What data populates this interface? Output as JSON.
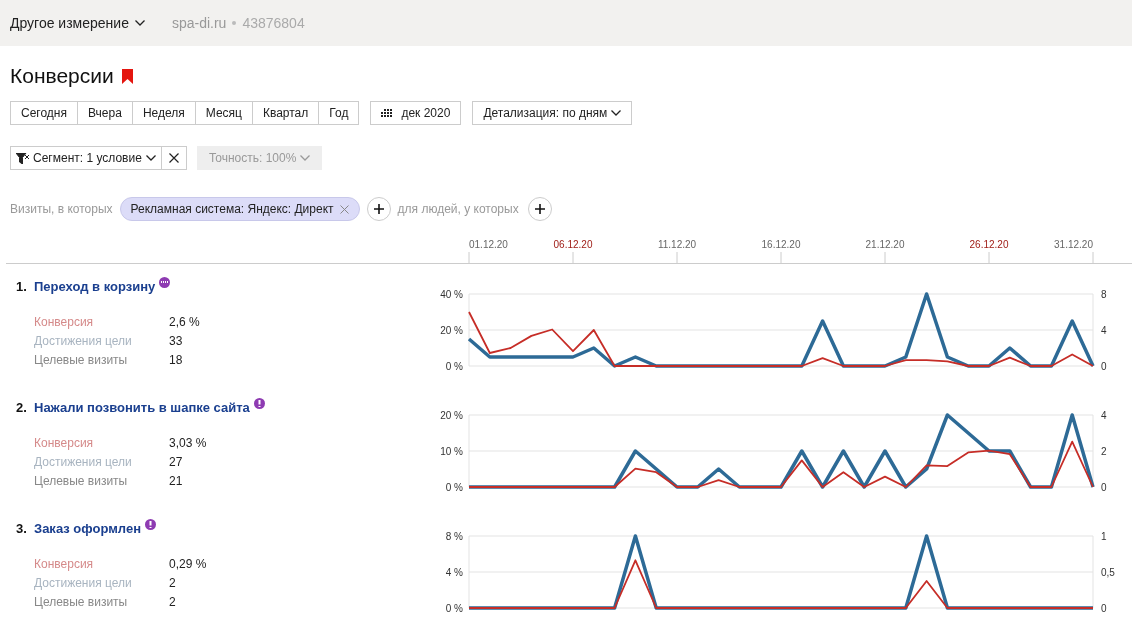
{
  "header": {
    "dimension_menu": "Другое измерение",
    "site": "spa-di.ru",
    "counter_id": "43876804"
  },
  "page_title": "Конверсии",
  "period_buttons": [
    {
      "label": "Сегодня",
      "selected": false
    },
    {
      "label": "Вчера",
      "selected": false
    },
    {
      "label": "Неделя",
      "selected": false
    },
    {
      "label": "Месяц",
      "selected": false
    },
    {
      "label": "Квартал",
      "selected": false
    },
    {
      "label": "Год",
      "selected": false
    }
  ],
  "date_picker": "дек 2020",
  "detail_dropdown": "Детализация: по дням",
  "segment": {
    "label": "Сегмент: 1 условие",
    "accuracy": "Точность: 100%",
    "accuracy_disabled": true
  },
  "filter": {
    "prefix": "Визиты, в которых",
    "chip": "Рекламная система: Яндекс: Директ",
    "people_label": "для людей, у которых"
  },
  "date_axis": [
    {
      "label": "01.12.20",
      "weekend": false
    },
    {
      "label": "06.12.20",
      "weekend": true
    },
    {
      "label": "11.12.20",
      "weekend": false
    },
    {
      "label": "16.12.20",
      "weekend": false
    },
    {
      "label": "21.12.20",
      "weekend": false
    },
    {
      "label": "26.12.20",
      "weekend": true
    },
    {
      "label": "31.12.20",
      "weekend": false
    }
  ],
  "goals": [
    {
      "number": "1.",
      "title": "Переход в корзину",
      "kind": "url",
      "metrics": [
        {
          "label": "Конверсия",
          "value": "2,6 %",
          "color": "#d58a8a"
        },
        {
          "label": "Достижения цели",
          "value": "33",
          "color": "#a8b4c0"
        },
        {
          "label": "Целевые визиты",
          "value": "18",
          "color": "#888888"
        }
      ],
      "chart_data": {
        "type": "line",
        "ylim": [
          0,
          40
        ],
        "yticks": [
          {
            "value": 0,
            "label": "0 %"
          },
          {
            "value": 20,
            "label": "20 %"
          },
          {
            "value": 40,
            "label": "40 %"
          }
        ],
        "y2lim": [
          0,
          8
        ],
        "y2ticks": [
          {
            "value": 0,
            "label": "0"
          },
          {
            "value": 4,
            "label": "4"
          },
          {
            "value": 8,
            "label": "8"
          }
        ],
        "series": [
          {
            "color": "#c62d27",
            "values": [
              30,
              7.2,
              10,
              16.7,
              20.3,
              8.2,
              20,
              0,
              0,
              0,
              0,
              0,
              0,
              0,
              0,
              0,
              0,
              4.4,
              0,
              0,
              0,
              3.3,
              3.2,
              2.6,
              0,
              0,
              4.6,
              0,
              0,
              6.4,
              0
            ]
          },
          {
            "color": "#2d6a96",
            "axis": "y2",
            "values": [
              3,
              1,
              1,
              1,
              1,
              1,
              2,
              0,
              1,
              0,
              0,
              0,
              0,
              0,
              0,
              0,
              0,
              5,
              0,
              0,
              0,
              1,
              8,
              1,
              0,
              0,
              2,
              0,
              0,
              5,
              0
            ]
          }
        ]
      }
    },
    {
      "number": "2.",
      "title": "Нажали позвонить в шапке сайта",
      "kind": "alert",
      "metrics": [
        {
          "label": "Конверсия",
          "value": "3,03 %",
          "color": "#d58a8a"
        },
        {
          "label": "Достижения цели",
          "value": "27",
          "color": "#a8b4c0"
        },
        {
          "label": "Целевые визиты",
          "value": "21",
          "color": "#888888"
        }
      ],
      "chart_data": {
        "type": "line",
        "ylim": [
          0,
          20
        ],
        "yticks": [
          {
            "value": 0,
            "label": "0 %"
          },
          {
            "value": 10,
            "label": "10 %"
          },
          {
            "value": 20,
            "label": "20 %"
          }
        ],
        "y2lim": [
          0,
          4
        ],
        "y2ticks": [
          {
            "value": 0,
            "label": "0"
          },
          {
            "value": 2,
            "label": "2"
          },
          {
            "value": 4,
            "label": "4"
          }
        ],
        "series": [
          {
            "color": "#c62d27",
            "values": [
              0,
              0,
              0,
              0,
              0,
              0,
              0,
              0,
              5.1,
              4.1,
              0,
              0,
              1.9,
              0,
              0,
              0,
              7.4,
              0,
              4.1,
              0,
              2.9,
              0,
              6,
              5.8,
              9.6,
              10.1,
              9.1,
              0,
              0,
              12.6,
              0
            ]
          },
          {
            "color": "#2d6a96",
            "axis": "y2",
            "values": [
              0,
              0,
              0,
              0,
              0,
              0,
              0,
              0,
              2,
              1,
              0,
              0,
              1,
              0,
              0,
              0,
              2,
              0,
              2,
              0,
              2,
              0,
              1,
              4,
              3,
              2,
              2,
              0,
              0,
              4,
              0
            ]
          }
        ]
      }
    },
    {
      "number": "3.",
      "title": "Заказ оформлен",
      "kind": "alert",
      "metrics": [
        {
          "label": "Конверсия",
          "value": "0,29 %",
          "color": "#d58a8a"
        },
        {
          "label": "Достижения цели",
          "value": "2",
          "color": "#a8b4c0"
        },
        {
          "label": "Целевые визиты",
          "value": "2",
          "color": "#888888"
        }
      ],
      "chart_data": {
        "type": "line",
        "ylim": [
          0,
          8
        ],
        "yticks": [
          {
            "value": 0,
            "label": "0 %"
          },
          {
            "value": 4,
            "label": "4 %"
          },
          {
            "value": 8,
            "label": "8 %"
          }
        ],
        "y2lim": [
          0,
          1
        ],
        "y2ticks": [
          {
            "value": 0,
            "label": "0"
          },
          {
            "value": 0.5,
            "label": "0,5"
          },
          {
            "value": 1,
            "label": "1"
          }
        ],
        "series": [
          {
            "color": "#c62d27",
            "values": [
              0,
              0,
              0,
              0,
              0,
              0,
              0,
              0,
              5.3,
              0,
              0,
              0,
              0,
              0,
              0,
              0,
              0,
              0,
              0,
              0,
              0,
              0,
              3,
              0,
              0,
              0,
              0,
              0,
              0,
              0,
              0
            ]
          },
          {
            "color": "#2d6a96",
            "axis": "y2",
            "values": [
              0,
              0,
              0,
              0,
              0,
              0,
              0,
              0,
              1,
              0,
              0,
              0,
              0,
              0,
              0,
              0,
              0,
              0,
              0,
              0,
              0,
              0,
              1,
              0,
              0,
              0,
              0,
              0,
              0,
              0,
              0
            ]
          }
        ]
      }
    }
  ]
}
